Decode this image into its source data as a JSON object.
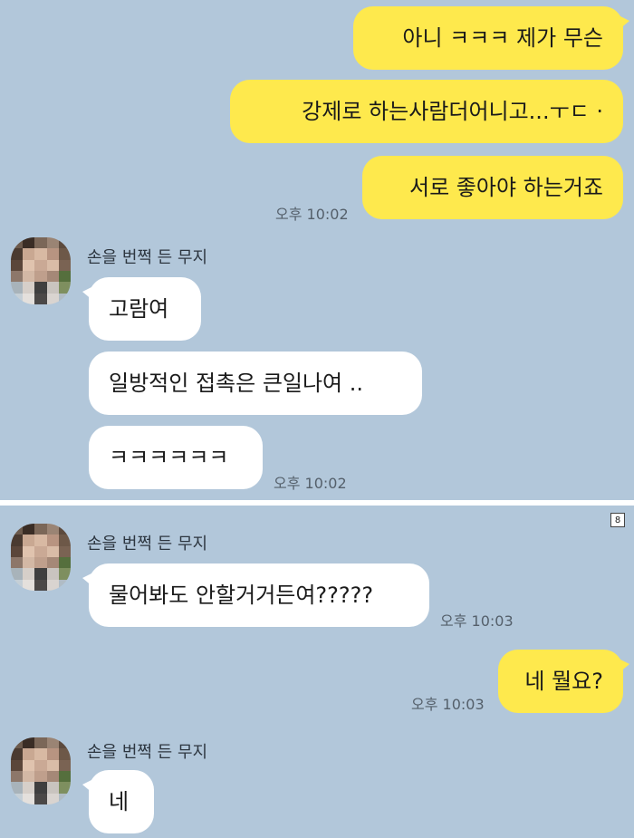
{
  "contact_name": "손을 번쩍 든 무지",
  "top_screenshot": {
    "messages": [
      {
        "text": "아니 ㅋㅋㅋ 제가 무슨"
      },
      {
        "text": "강제로 하는사람더어니고...ㅜㄷ ·"
      },
      {
        "text": "서로 좋아야 하는거죠",
        "time": "오후 10:02"
      },
      {
        "text": "고람여"
      },
      {
        "text": "일방적인 접촉은 큰일나여 .."
      },
      {
        "text": "ㅋㅋㅋㅋㅋㅋ",
        "time": "오후 10:02"
      }
    ]
  },
  "bottom_screenshot": {
    "page_badge": "8",
    "messages": [
      {
        "text": "물어봐도 안할거거든여?????",
        "time": "오후 10:03"
      },
      {
        "text": "네 뭘요?",
        "time": "오후 10:03"
      },
      {
        "text": "네"
      }
    ]
  },
  "colors": {
    "chat_background": "#b2c7da",
    "my_bubble": "#fee94d",
    "their_bubble": "#ffffff"
  }
}
